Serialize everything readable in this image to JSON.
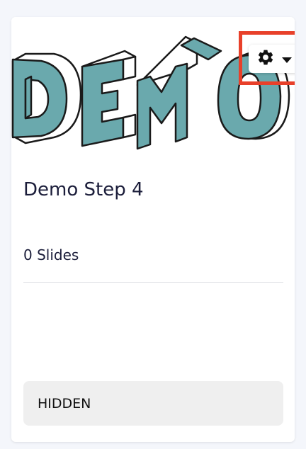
{
  "card": {
    "logo_text": "DEMO",
    "title": "Demo Step 4",
    "slides_count": "0 Slides",
    "status": "HIDDEN"
  },
  "settings": {
    "icon": "gear-icon",
    "caret": "caret-down-icon"
  },
  "colors": {
    "page_background": "#f4f6fb",
    "logo_fill": "#6aa9ad",
    "logo_outline": "#1a1a1a",
    "highlight": "#e8402a",
    "title_text": "#1b1d3a",
    "status_background": "#efefef"
  }
}
